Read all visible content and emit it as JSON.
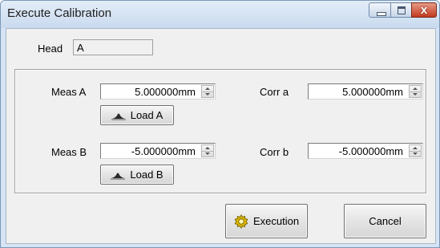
{
  "window": {
    "title": "Execute Calibration",
    "controls": [
      "minimize",
      "maximize",
      "close"
    ]
  },
  "head": {
    "label": "Head",
    "value": "A"
  },
  "measurements": {
    "meas_a": {
      "label": "Meas A",
      "value": "5.000000mm"
    },
    "meas_b": {
      "label": "Meas B",
      "value": "-5.000000mm"
    },
    "corr_a": {
      "label": "Corr a",
      "value": "5.000000mm"
    },
    "corr_b": {
      "label": "Corr b",
      "value": "-5.000000mm"
    }
  },
  "buttons": {
    "load_a": "Load A",
    "load_b": "Load B",
    "execution": "Execution",
    "cancel": "Cancel"
  },
  "icons": {
    "load": "surface-profile-icon",
    "execution": "gear-icon",
    "close_glyph": "x"
  },
  "colors": {
    "titlebar": "#d6e4f3",
    "close_button": "#c2391d",
    "client_bg": "#f0f0f0"
  }
}
